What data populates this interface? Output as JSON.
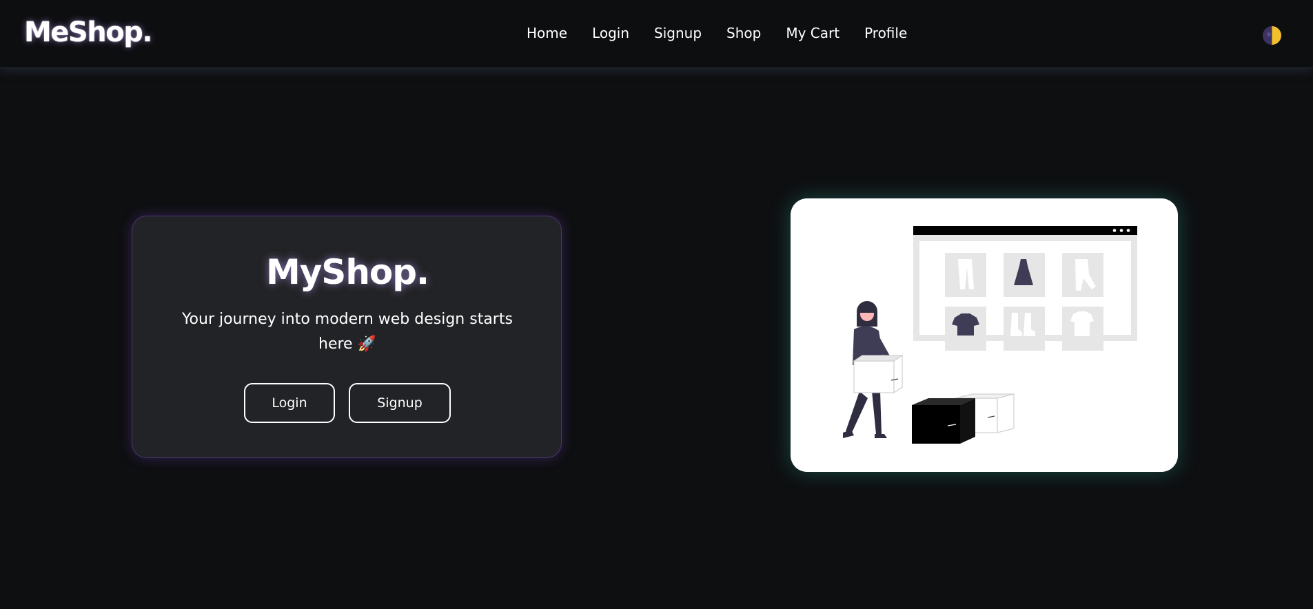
{
  "navbar": {
    "brand": "MeShop.",
    "links": [
      "Home",
      "Login",
      "Signup",
      "Shop",
      "My Cart",
      "Profile"
    ],
    "theme_toggle_icon": "half-moon-sun-icon"
  },
  "hero": {
    "title": "MyShop.",
    "tagline": "Your journey into modern web design starts here",
    "tagline_emoji": "🚀",
    "login_label": "Login",
    "signup_label": "Signup"
  },
  "illustration": {
    "icon": "online-shopping-illustration"
  },
  "colors": {
    "background": "#0e0f11",
    "card": "#222326",
    "card_glow": "#4b3670",
    "illustration_glow": "#2a8c82",
    "accent_purple": "#3f3d56",
    "toggle_moon": "#3e3360",
    "toggle_sun": "#f3c02b"
  }
}
